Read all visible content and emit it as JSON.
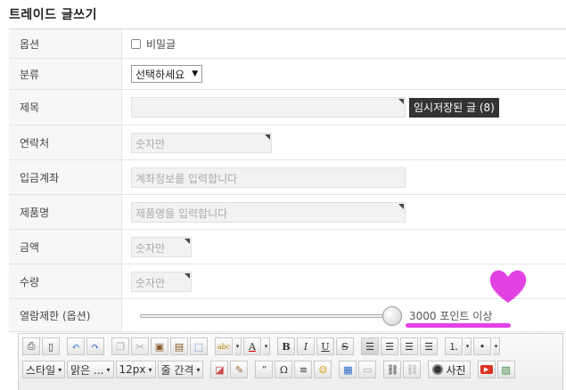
{
  "page": {
    "title": "트레이드 글쓰기"
  },
  "form": {
    "option": {
      "label": "옵션",
      "checkbox_label": "비밀글"
    },
    "category": {
      "label": "분류",
      "selected": "선택하세요"
    },
    "subject": {
      "label": "제목",
      "draft_button": "임시저장된 글 (8)"
    },
    "contact": {
      "label": "연락처",
      "placeholder": "숫자만"
    },
    "account": {
      "label": "입금계좌",
      "placeholder": "계좌정보를 입력합니다"
    },
    "product": {
      "label": "제품명",
      "placeholder": "제품명을 입력합니다"
    },
    "price": {
      "label": "금액",
      "placeholder": "숫자만"
    },
    "quantity": {
      "label": "수량",
      "placeholder": "숫자만"
    },
    "view_limit": {
      "label": "열람제한 (옵션)",
      "slider_text": "3000 포인트 이상",
      "slider_level": 1.0
    }
  },
  "editor": {
    "font_style": "스타일",
    "font_family": "맑은 ...",
    "font_size": "12px",
    "line_height": "줄 간격",
    "photo_label": "사진",
    "buttons": {
      "bold": "B",
      "italic": "I",
      "underline": "U",
      "strike": "S",
      "quote": "“",
      "omega": "Ω",
      "highlight": "abc"
    }
  },
  "annotations": {
    "highlight_color": "#e02ee0"
  }
}
